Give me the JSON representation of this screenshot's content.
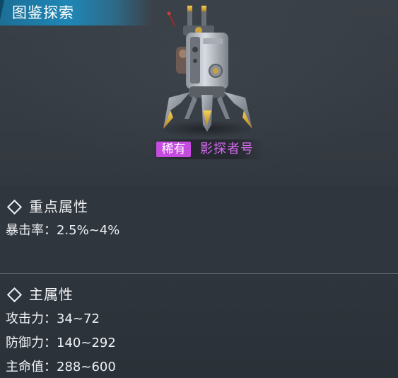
{
  "header": {
    "title": "图鉴探索"
  },
  "unit": {
    "rarity": "稀有",
    "name": "影探者号",
    "rarity_color": "#c64be0",
    "name_color": "#d46cf0",
    "image_icon": "tripod-robot-icon"
  },
  "key_attributes": {
    "title": "重点属性",
    "stats": [
      {
        "text": "暴击率：2.5%~4%"
      }
    ]
  },
  "main_attributes": {
    "title": "主属性",
    "stats": [
      {
        "text": "攻击力：34~72"
      },
      {
        "text": "防御力：140~292"
      },
      {
        "text": "主命值：288~600"
      }
    ]
  },
  "colors": {
    "title_banner": "#1f87b6",
    "panel_bg": "#2f363d",
    "divider": "#5d646c"
  }
}
